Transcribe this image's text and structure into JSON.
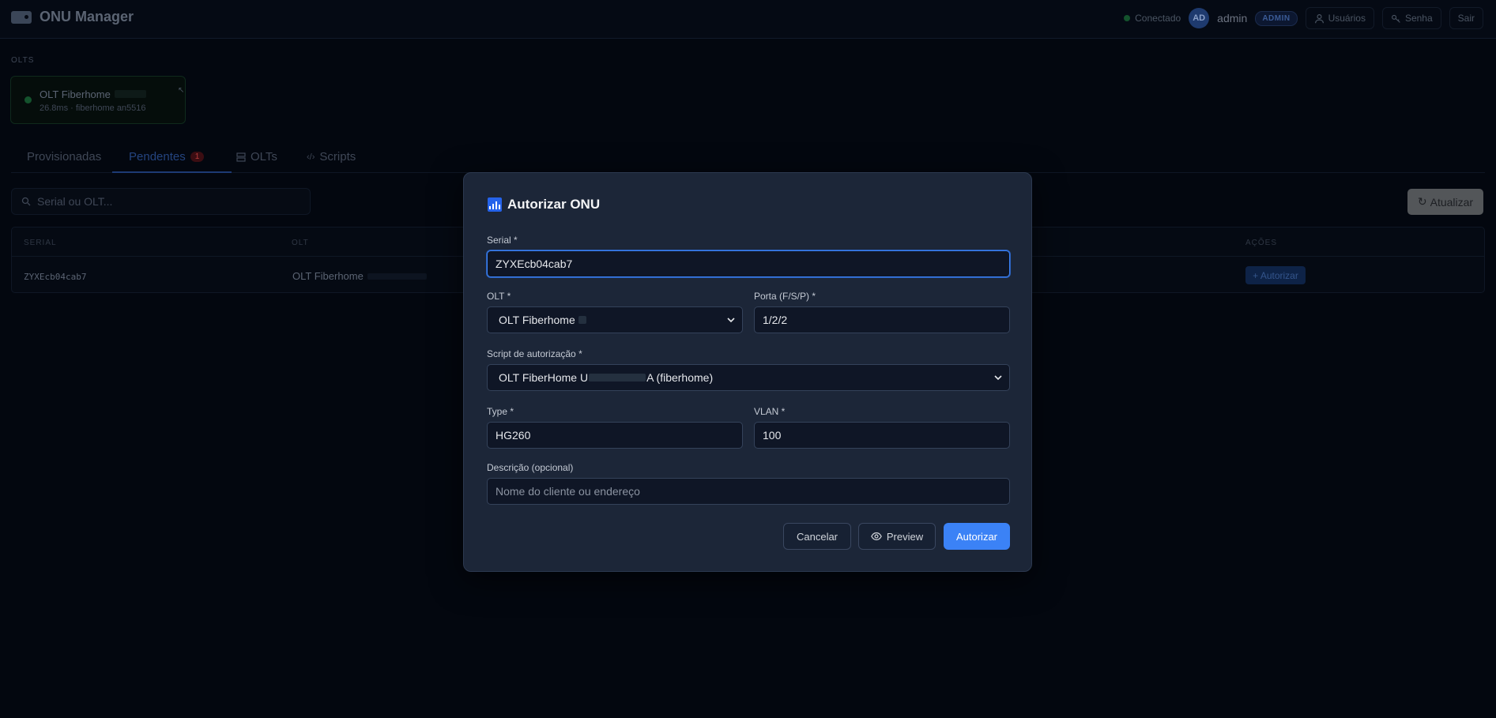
{
  "header": {
    "app_title": "ONU Manager",
    "status": "Conectado",
    "avatar_initials": "AD",
    "username": "admin",
    "role": "ADMIN",
    "users_label": "Usuários",
    "password_label": "Senha",
    "logout_label": "Sair"
  },
  "olts_section": {
    "label": "OLTS",
    "card": {
      "name": "OLT Fiberhome",
      "meta": "26.8ms · fiberhome an5516"
    }
  },
  "tabs": [
    {
      "label": "Provisionadas"
    },
    {
      "label": "Pendentes",
      "count": "1"
    },
    {
      "label": "OLTs"
    },
    {
      "label": "Scripts"
    }
  ],
  "search": {
    "placeholder": "Serial ou OLT..."
  },
  "refresh_label": "Atualizar",
  "table": {
    "headers": [
      "SERIAL",
      "OLT",
      "AÇÕES"
    ],
    "rows": [
      {
        "serial": "ZYXEcb04cab7",
        "olt": "OLT Fiberhome",
        "action": "+ Autorizar"
      }
    ]
  },
  "modal": {
    "title": "Autorizar ONU",
    "serial_label": "Serial *",
    "serial_value": "ZYXEcb04cab7",
    "olt_label": "OLT *",
    "olt_value": "OLT Fiberhome",
    "port_label": "Porta (F/S/P) *",
    "port_value": "1/2/2",
    "script_label": "Script de autorização *",
    "script_value_prefix": "OLT FiberHome U",
    "script_value_suffix": "A (fiberhome)",
    "type_label": "Type *",
    "type_value": "HG260",
    "vlan_label": "VLAN *",
    "vlan_value": "100",
    "desc_label": "Descrição (opcional)",
    "desc_placeholder": "Nome do cliente ou endereço",
    "cancel_label": "Cancelar",
    "preview_label": "Preview",
    "authorize_label": "Autorizar"
  }
}
